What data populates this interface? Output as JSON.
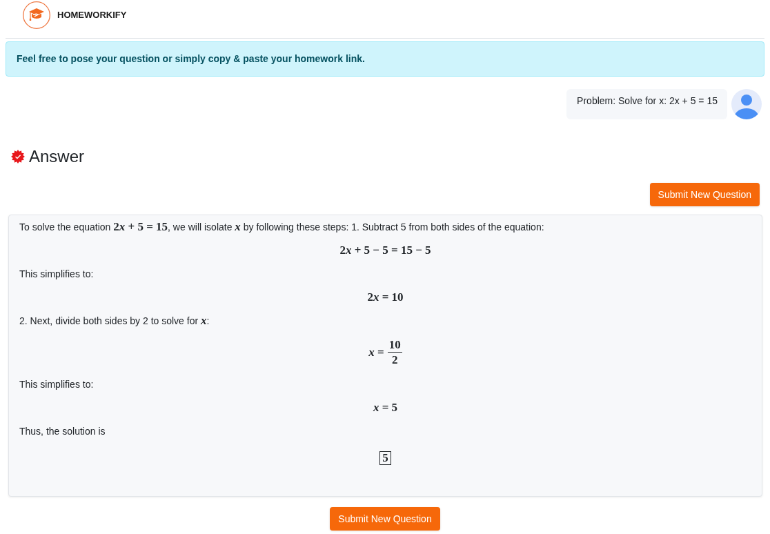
{
  "header": {
    "brand": "HOMEWORKIFY"
  },
  "notice": {
    "text": "Feel free to pose your question or simply copy & paste your homework link."
  },
  "question": {
    "text": "Problem: Solve for x: 2x + 5 = 15"
  },
  "answer": {
    "title": "Answer",
    "top_button": {
      "label": "Submit New Question"
    },
    "blocks": [
      {
        "kind": "text",
        "segments": [
          {
            "kind": "plain",
            "text": "To solve the equation "
          },
          {
            "kind": "math",
            "tokens": [
              {
                "kind": "num",
                "text": "2"
              },
              {
                "kind": "var",
                "text": "x"
              },
              {
                "kind": "num",
                "text": " + 5 = 15"
              }
            ]
          },
          {
            "kind": "plain",
            "text": ", we will isolate "
          },
          {
            "kind": "math",
            "tokens": [
              {
                "kind": "var",
                "text": "x"
              }
            ]
          },
          {
            "kind": "plain",
            "text": " by following these steps: 1. Subtract 5 from both sides of the equation:"
          }
        ]
      },
      {
        "kind": "display",
        "tokens": [
          {
            "kind": "num",
            "text": "2"
          },
          {
            "kind": "var",
            "text": "x"
          },
          {
            "kind": "num",
            "text": " + 5 − 5 = 15 − 5"
          }
        ]
      },
      {
        "kind": "text",
        "segments": [
          {
            "kind": "plain",
            "text": "This simplifies to:"
          }
        ]
      },
      {
        "kind": "display",
        "tokens": [
          {
            "kind": "num",
            "text": "2"
          },
          {
            "kind": "var",
            "text": "x"
          },
          {
            "kind": "num",
            "text": " = 10"
          }
        ]
      },
      {
        "kind": "text",
        "segments": [
          {
            "kind": "plain",
            "text": "2. Next, divide both sides by 2 to solve for "
          },
          {
            "kind": "math",
            "tokens": [
              {
                "kind": "var",
                "text": "x"
              }
            ]
          },
          {
            "kind": "plain",
            "text": ":"
          }
        ]
      },
      {
        "kind": "fraction",
        "tokens": [
          {
            "kind": "var",
            "text": "x"
          },
          {
            "kind": "num",
            "text": " ="
          }
        ],
        "numerator": "10",
        "denominator": "2"
      },
      {
        "kind": "text",
        "segments": [
          {
            "kind": "plain",
            "text": "This simplifies to:"
          }
        ]
      },
      {
        "kind": "display",
        "tokens": [
          {
            "kind": "var",
            "text": "x"
          },
          {
            "kind": "num",
            "text": " = 5"
          }
        ]
      },
      {
        "kind": "text",
        "segments": [
          {
            "kind": "plain",
            "text": "Thus, the solution is"
          }
        ]
      },
      {
        "kind": "boxed",
        "tokens": [
          {
            "kind": "num",
            "text": "5"
          }
        ]
      }
    ]
  },
  "bottom_button": {
    "label": "Submit New Question"
  }
}
